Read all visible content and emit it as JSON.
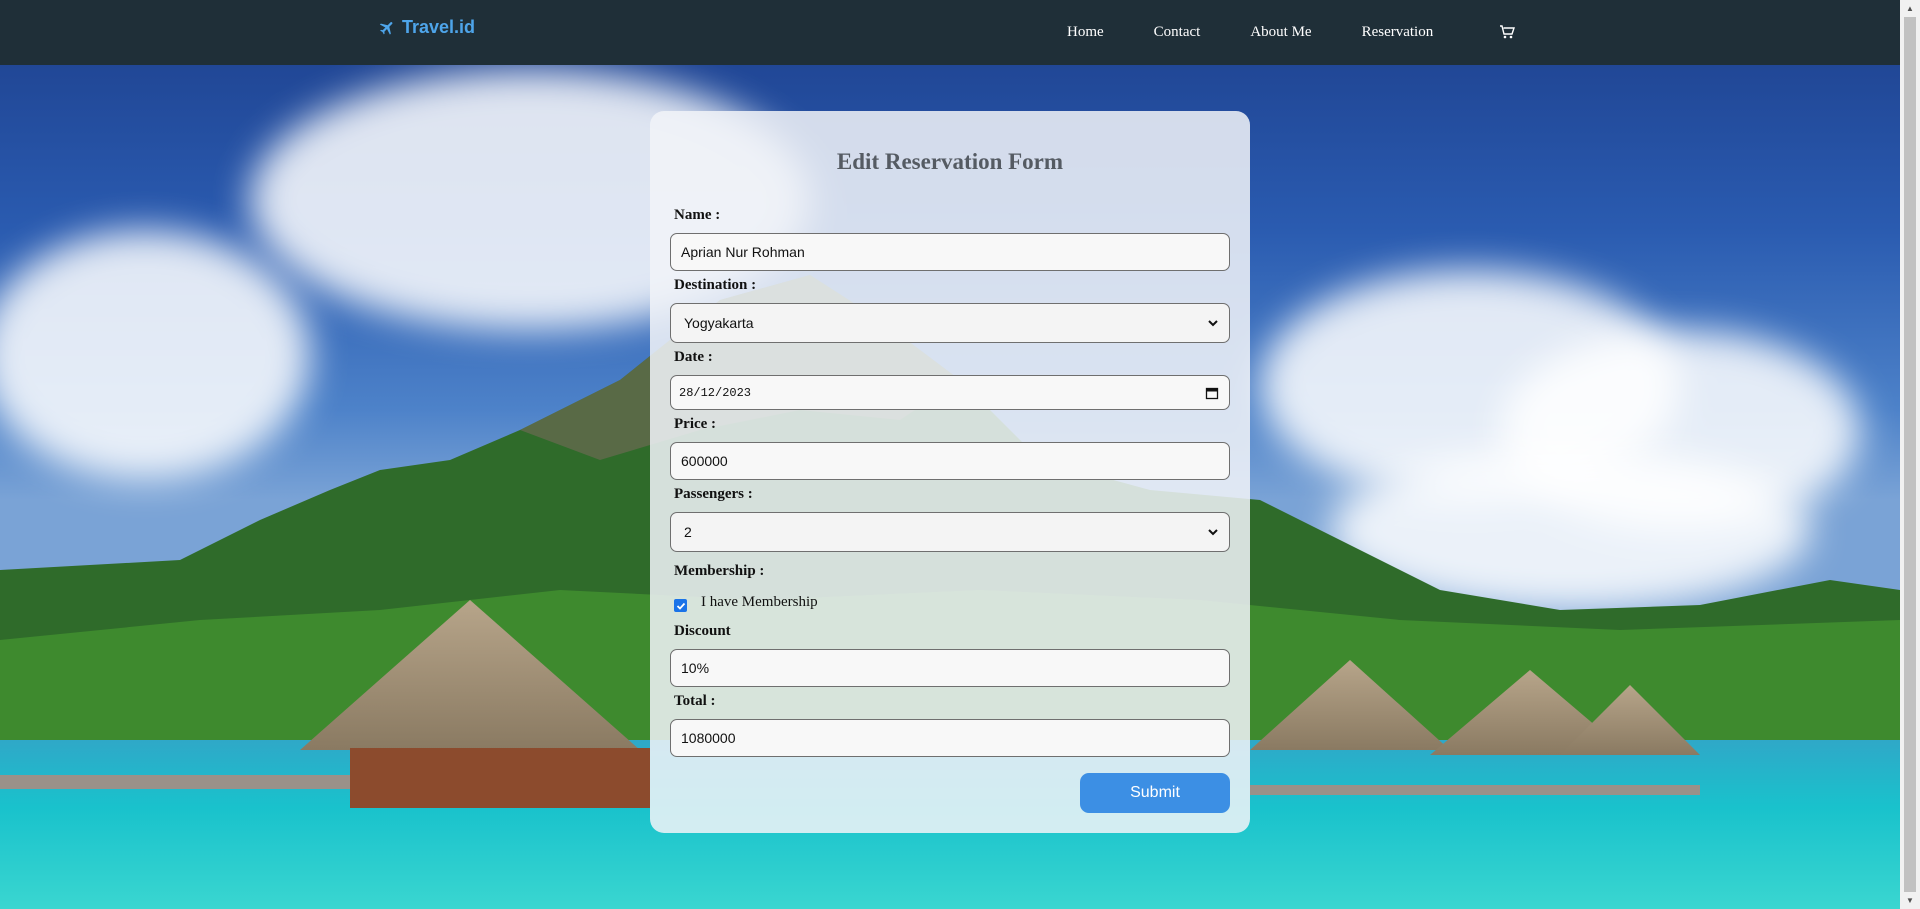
{
  "brand": {
    "name": "Travel.id"
  },
  "nav": {
    "items": [
      "Home",
      "Contact",
      "About Me",
      "Reservation"
    ]
  },
  "form": {
    "title": "Edit Reservation Form",
    "name_label": "Name :",
    "name_value": "Aprian Nur Rohman",
    "destination_label": "Destination :",
    "destination_value": "Yogyakarta",
    "date_label": "Date :",
    "date_value": "28/12/2023",
    "price_label": "Price :",
    "price_value": "600000",
    "passengers_label": "Passengers :",
    "passengers_value": "2",
    "membership_label": "Membership :",
    "membership_checkbox_label": "I have Membership",
    "membership_checked": true,
    "discount_label": "Discount",
    "discount_value": "10%",
    "total_label": "Total :",
    "total_value": "1080000",
    "submit_label": "Submit"
  },
  "colors": {
    "navbar": "#1f2f38",
    "brand": "#4ea5ea",
    "submit": "#3c8fe4"
  }
}
